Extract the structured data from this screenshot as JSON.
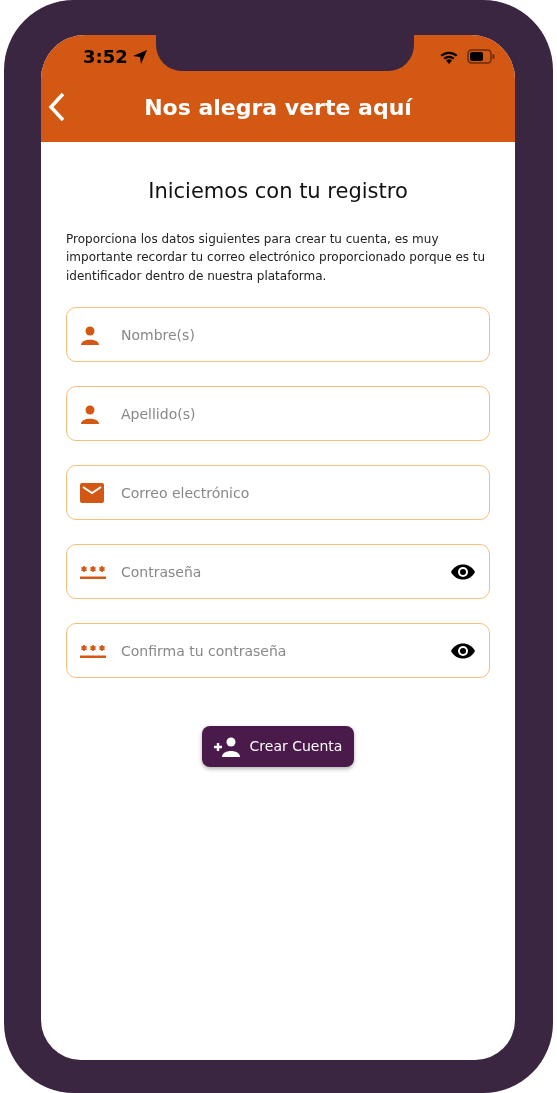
{
  "status_bar": {
    "time": "3:52"
  },
  "header": {
    "title": "Nos alegra verte aquí"
  },
  "heading": "Iniciemos con tu registro",
  "intro": "Proporciona los datos siguientes para crear tu cuenta, es muy importante recordar tu correo electrónico proporcionado porque es tu identificador dentro de nuestra plataforma.",
  "fields": [
    {
      "kind": "person",
      "placeholder": "Nombre(s)"
    },
    {
      "kind": "person",
      "placeholder": "Apellido(s)"
    },
    {
      "kind": "email",
      "placeholder": "Correo electrónico"
    },
    {
      "kind": "password",
      "placeholder": "Contraseña"
    },
    {
      "kind": "password",
      "placeholder": "Confirma tu contraseña"
    }
  ],
  "submit_button": {
    "label": "Crear Cuenta"
  }
}
